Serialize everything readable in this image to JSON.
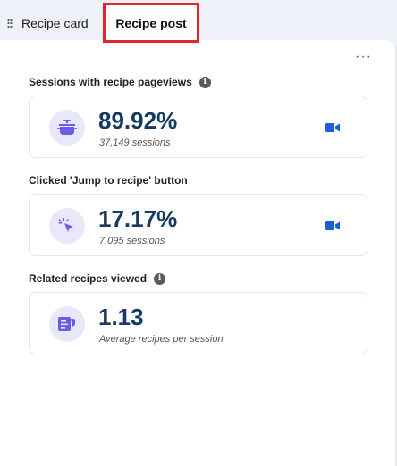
{
  "tabs": {
    "recipe_card": "Recipe card",
    "recipe_post": "Recipe post"
  },
  "more_menu": "···",
  "metrics": [
    {
      "label": "Sessions with recipe pageviews",
      "value": "89.92%",
      "sub": "37,149 sessions",
      "icon": "cooking-pot-icon"
    },
    {
      "label": "Clicked 'Jump to recipe' button",
      "value": "17.17%",
      "sub": "7,095 sessions",
      "icon": "cursor-click-icon"
    },
    {
      "label": "Related recipes viewed",
      "value": "1.13",
      "sub": "Average recipes per session",
      "icon": "recipe-document-icon"
    }
  ],
  "info_glyph": "i",
  "colors": {
    "accent": "#6b5ce7",
    "value_text": "#173a63",
    "video_icon": "#1a5fd6",
    "highlight_border": "#e3242b"
  }
}
